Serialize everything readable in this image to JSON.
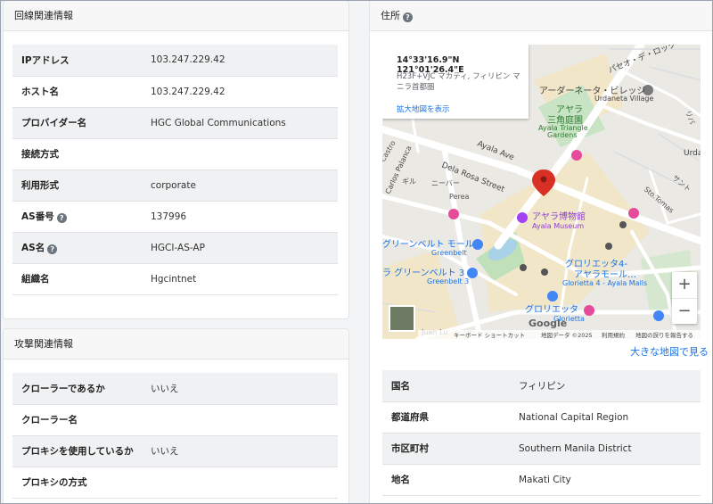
{
  "line_info": {
    "title": "回線関連情報",
    "rows": [
      {
        "label": "IPアドレス",
        "value": "103.247.229.42",
        "help": false
      },
      {
        "label": "ホスト名",
        "value": "103.247.229.42",
        "help": false
      },
      {
        "label": "プロバイダー名",
        "value": "HGC Global Communications",
        "help": false
      },
      {
        "label": "接続方式",
        "value": "",
        "help": false
      },
      {
        "label": "利用形式",
        "value": "corporate",
        "help": false
      },
      {
        "label": "AS番号",
        "value": "137996",
        "help": true
      },
      {
        "label": "AS名",
        "value": "HGCI-AS-AP",
        "help": true
      },
      {
        "label": "組織名",
        "value": "Hgcintnet",
        "help": false
      }
    ]
  },
  "attack_info": {
    "title": "攻撃関連情報",
    "rows": [
      {
        "label": "クローラーであるか",
        "value": "いいえ"
      },
      {
        "label": "クローラー名",
        "value": ""
      },
      {
        "label": "プロキシを使用しているか",
        "value": "いいえ"
      },
      {
        "label": "プロキシの方式",
        "value": ""
      }
    ]
  },
  "address": {
    "title": "住所",
    "help_glyph": "?",
    "big_map_link": "大きな地図で見る",
    "rows": [
      {
        "label": "国名",
        "value": "フィリピン"
      },
      {
        "label": "都道府県",
        "value": "National Capital Region"
      },
      {
        "label": "市区町村",
        "value": "Southern Manila District"
      },
      {
        "label": "地名",
        "value": "Makati City"
      }
    ]
  },
  "map": {
    "coords": "14°33'16.9\"N 121°01'26.4\"E",
    "address_line": "H23F+VJC マカティ, フィリピン マニラ首都圏",
    "enlarge_link": "拡大地図を表示",
    "zoom_in": "+",
    "zoom_out": "−",
    "google_logo": "Google",
    "footer": {
      "shortcuts": "キーボード ショートカット",
      "map_data": "地図データ ©2025",
      "terms": "利用規約",
      "report": "地図の誤りを報告する"
    },
    "labels": {
      "ayala_ave": "Ayala Ave",
      "dela_rosa": "Dela Rosa Street",
      "perea": "Perea",
      "castro": "Castro",
      "carlos_palanca": "Carlos Palanca",
      "sto_tomas": "Sto.Tomas",
      "ayala_museum_jp": "アヤラ博物館",
      "ayala_museum_en": "Ayala Museum",
      "greenbelt_mall_jp": "グリーンベルト モール",
      "greenbelt_en": "Greenbelt",
      "greenbelt3_jp": "ラ グリーンベルト 3",
      "greenbelt3_en": "Greenbelt 3",
      "glorietta4_jp": "グロリエッタ4-",
      "glorietta4_jp2": "アヤラモール…",
      "glorietta4_en": "Glorietta 4 - Ayala Malls",
      "glorietta_jp": "グロリエッタ",
      "glorietta_en": "Glorietta",
      "ayala_triangle_jp": "アヤラ",
      "ayala_triangle_jp2": "三角庭園",
      "ayala_triangle_en": "Ayala Triangle",
      "ayala_triangle_en2": "Gardens",
      "urdaneta_jp": "アーダーネータ・ビレッジ",
      "urdaneta_en": "Urdaneta Village",
      "paseo_de_roxas": "パセオ・デ・ロック",
      "urdan": "Urda",
      "sunto": "サント",
      "juan_luna": "Juan Lu",
      "nee": "ニーバー",
      "giru": "ギル",
      "riba": "リバ"
    }
  }
}
